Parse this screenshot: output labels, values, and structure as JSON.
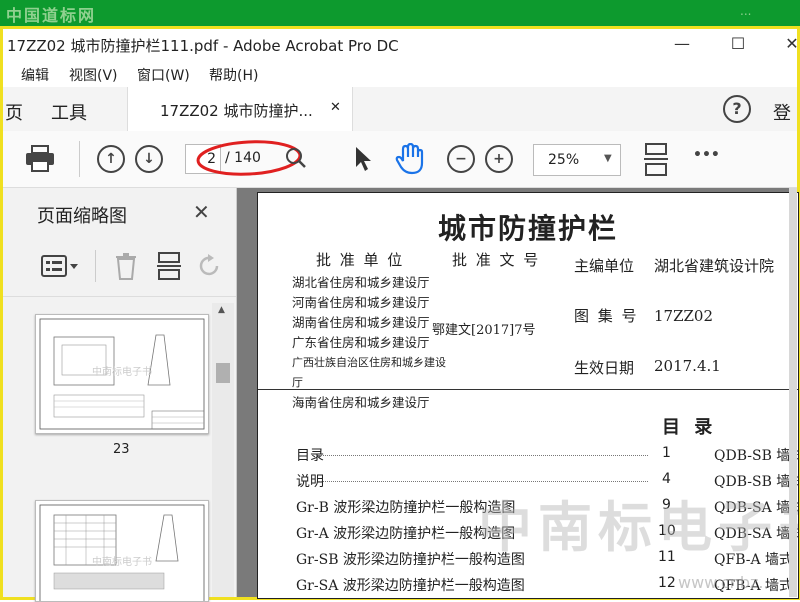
{
  "watermark": {
    "site": "中国道标网",
    "corner": "..."
  },
  "window": {
    "title": "17ZZ02 城市防撞护栏111.pdf - Adobe Acrobat Pro DC",
    "min": "—",
    "max": "☐",
    "close": "✕"
  },
  "menu": [
    "编辑",
    "视图(V)",
    "窗口(W)",
    "帮助(H)"
  ],
  "tabs": {
    "home": "页",
    "tools": "工具",
    "doc": "17ZZ02 城市防撞护...",
    "close": "✕",
    "help": "?",
    "login": "登"
  },
  "toolbar": {
    "page_current": "2",
    "page_total": "/ 140",
    "zoom": "25%",
    "more": "•••"
  },
  "sidebar": {
    "title": "页面缩略图",
    "close": "✕",
    "thumbs": [
      {
        "label": "23",
        "wm": "中南标电子书"
      },
      {
        "label": "",
        "wm": "中南标电子书"
      }
    ]
  },
  "doc": {
    "title": "城市防撞护栏",
    "approval_unit_hdr": "批 准 单 位",
    "approval_doc_hdr": "批 准 文 号",
    "approval_units": [
      "湖北省住房和城乡建设厅",
      "河南省住房和城乡建设厅",
      "湖南省住房和城乡建设厅",
      "广东省住房和城乡建设厅",
      "广西壮族自治区住房和城乡建设厅",
      "海南省住房和城乡建设厅"
    ],
    "approval_doc": "鄂建文[2017]7号",
    "editor_label": "主编单位",
    "editor": "湖北省建筑设计院",
    "atlas_label": "图 集 号",
    "atlas": "17ZZ02",
    "date_label": "生效日期",
    "date": "2017.4.1",
    "toc_title": "目 录",
    "toc": [
      {
        "name": "目录",
        "page": "1",
        "right": "QDB-SB 墙式"
      },
      {
        "name": "说明",
        "page": "4",
        "right": "QDB-SB 墙式"
      },
      {
        "name": "Gr-B  波形梁边防撞护栏一般构造图",
        "page": "9",
        "right": "QDB-SA 墙式"
      },
      {
        "name": "Gr-A  波形梁边防撞护栏一般构造图",
        "page": "10",
        "right": "QDB-SA 墙式"
      },
      {
        "name": "Gr-SB  波形梁边防撞护栏一般构造图",
        "page": "11",
        "right": "QFB-A 墙式"
      },
      {
        "name": "Gr-SA  波形梁边防撞护栏一般构造图",
        "page": "12",
        "right": "QFB-A 墙式"
      }
    ],
    "watermark": "中南标电子书",
    "watermark_url": "www.cnbz..."
  },
  "colors": {
    "accent": "#1a73e8",
    "annotation": "#e02020"
  }
}
